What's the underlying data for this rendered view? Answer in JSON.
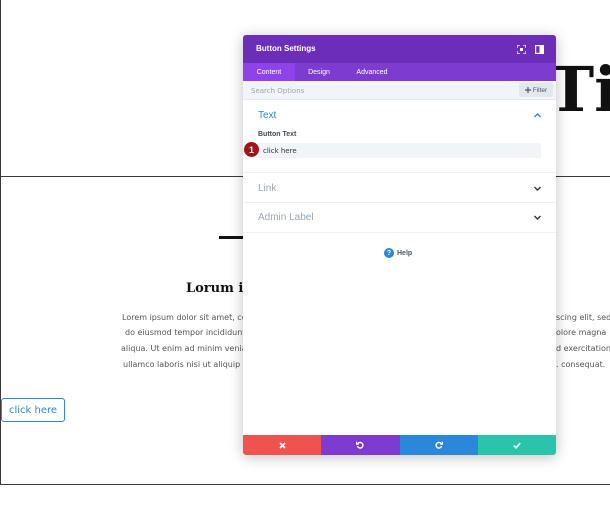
{
  "page": {
    "hero_title": "Tit",
    "heading": "Lorum ip",
    "paragraph_left": [
      "Lorem ipsum dolor sit amet, cons",
      "do eiusmod tempor incididunt u",
      "aliqua. Ut enim ad minim veniam",
      "ullamco laboris nisi ut aliquip ex"
    ],
    "paragraph_right": [
      "scing elit, sed",
      "olore magna",
      "d exercitation",
      ". consequat."
    ],
    "button_label": "click here"
  },
  "modal": {
    "title": "Button Settings",
    "header_icons": [
      "expand-icon",
      "sidebar-icon"
    ],
    "tabs": [
      {
        "label": "Content",
        "active": true
      },
      {
        "label": "Design",
        "active": false
      },
      {
        "label": "Advanced",
        "active": false
      }
    ],
    "search": {
      "placeholder": "Search Options",
      "filter_label": "Filter",
      "filter_icon": "plus-icon"
    },
    "sections": {
      "text": {
        "title": "Text",
        "state": "open"
      },
      "link": {
        "title": "Link",
        "state": "closed"
      },
      "admin_label": {
        "title": "Admin Label",
        "state": "closed"
      }
    },
    "button_text_field": {
      "label": "Button Text",
      "value": "click here"
    },
    "step_badge": "1",
    "help_label": "Help",
    "footer": [
      {
        "action": "discard",
        "icon": "close-icon",
        "color": "#ef5350"
      },
      {
        "action": "undo",
        "icon": "undo-icon",
        "color": "#7e3bd0"
      },
      {
        "action": "redo",
        "icon": "redo-icon",
        "color": "#2b87da"
      },
      {
        "action": "save",
        "icon": "check-icon",
        "color": "#29c4a9"
      }
    ]
  },
  "colors": {
    "header": "#6c2eb9",
    "tabs": "#7e3bd0",
    "active_tab": "#8f42ec",
    "accent_blue": "#2b87da",
    "badge_red": "#a0151a"
  }
}
